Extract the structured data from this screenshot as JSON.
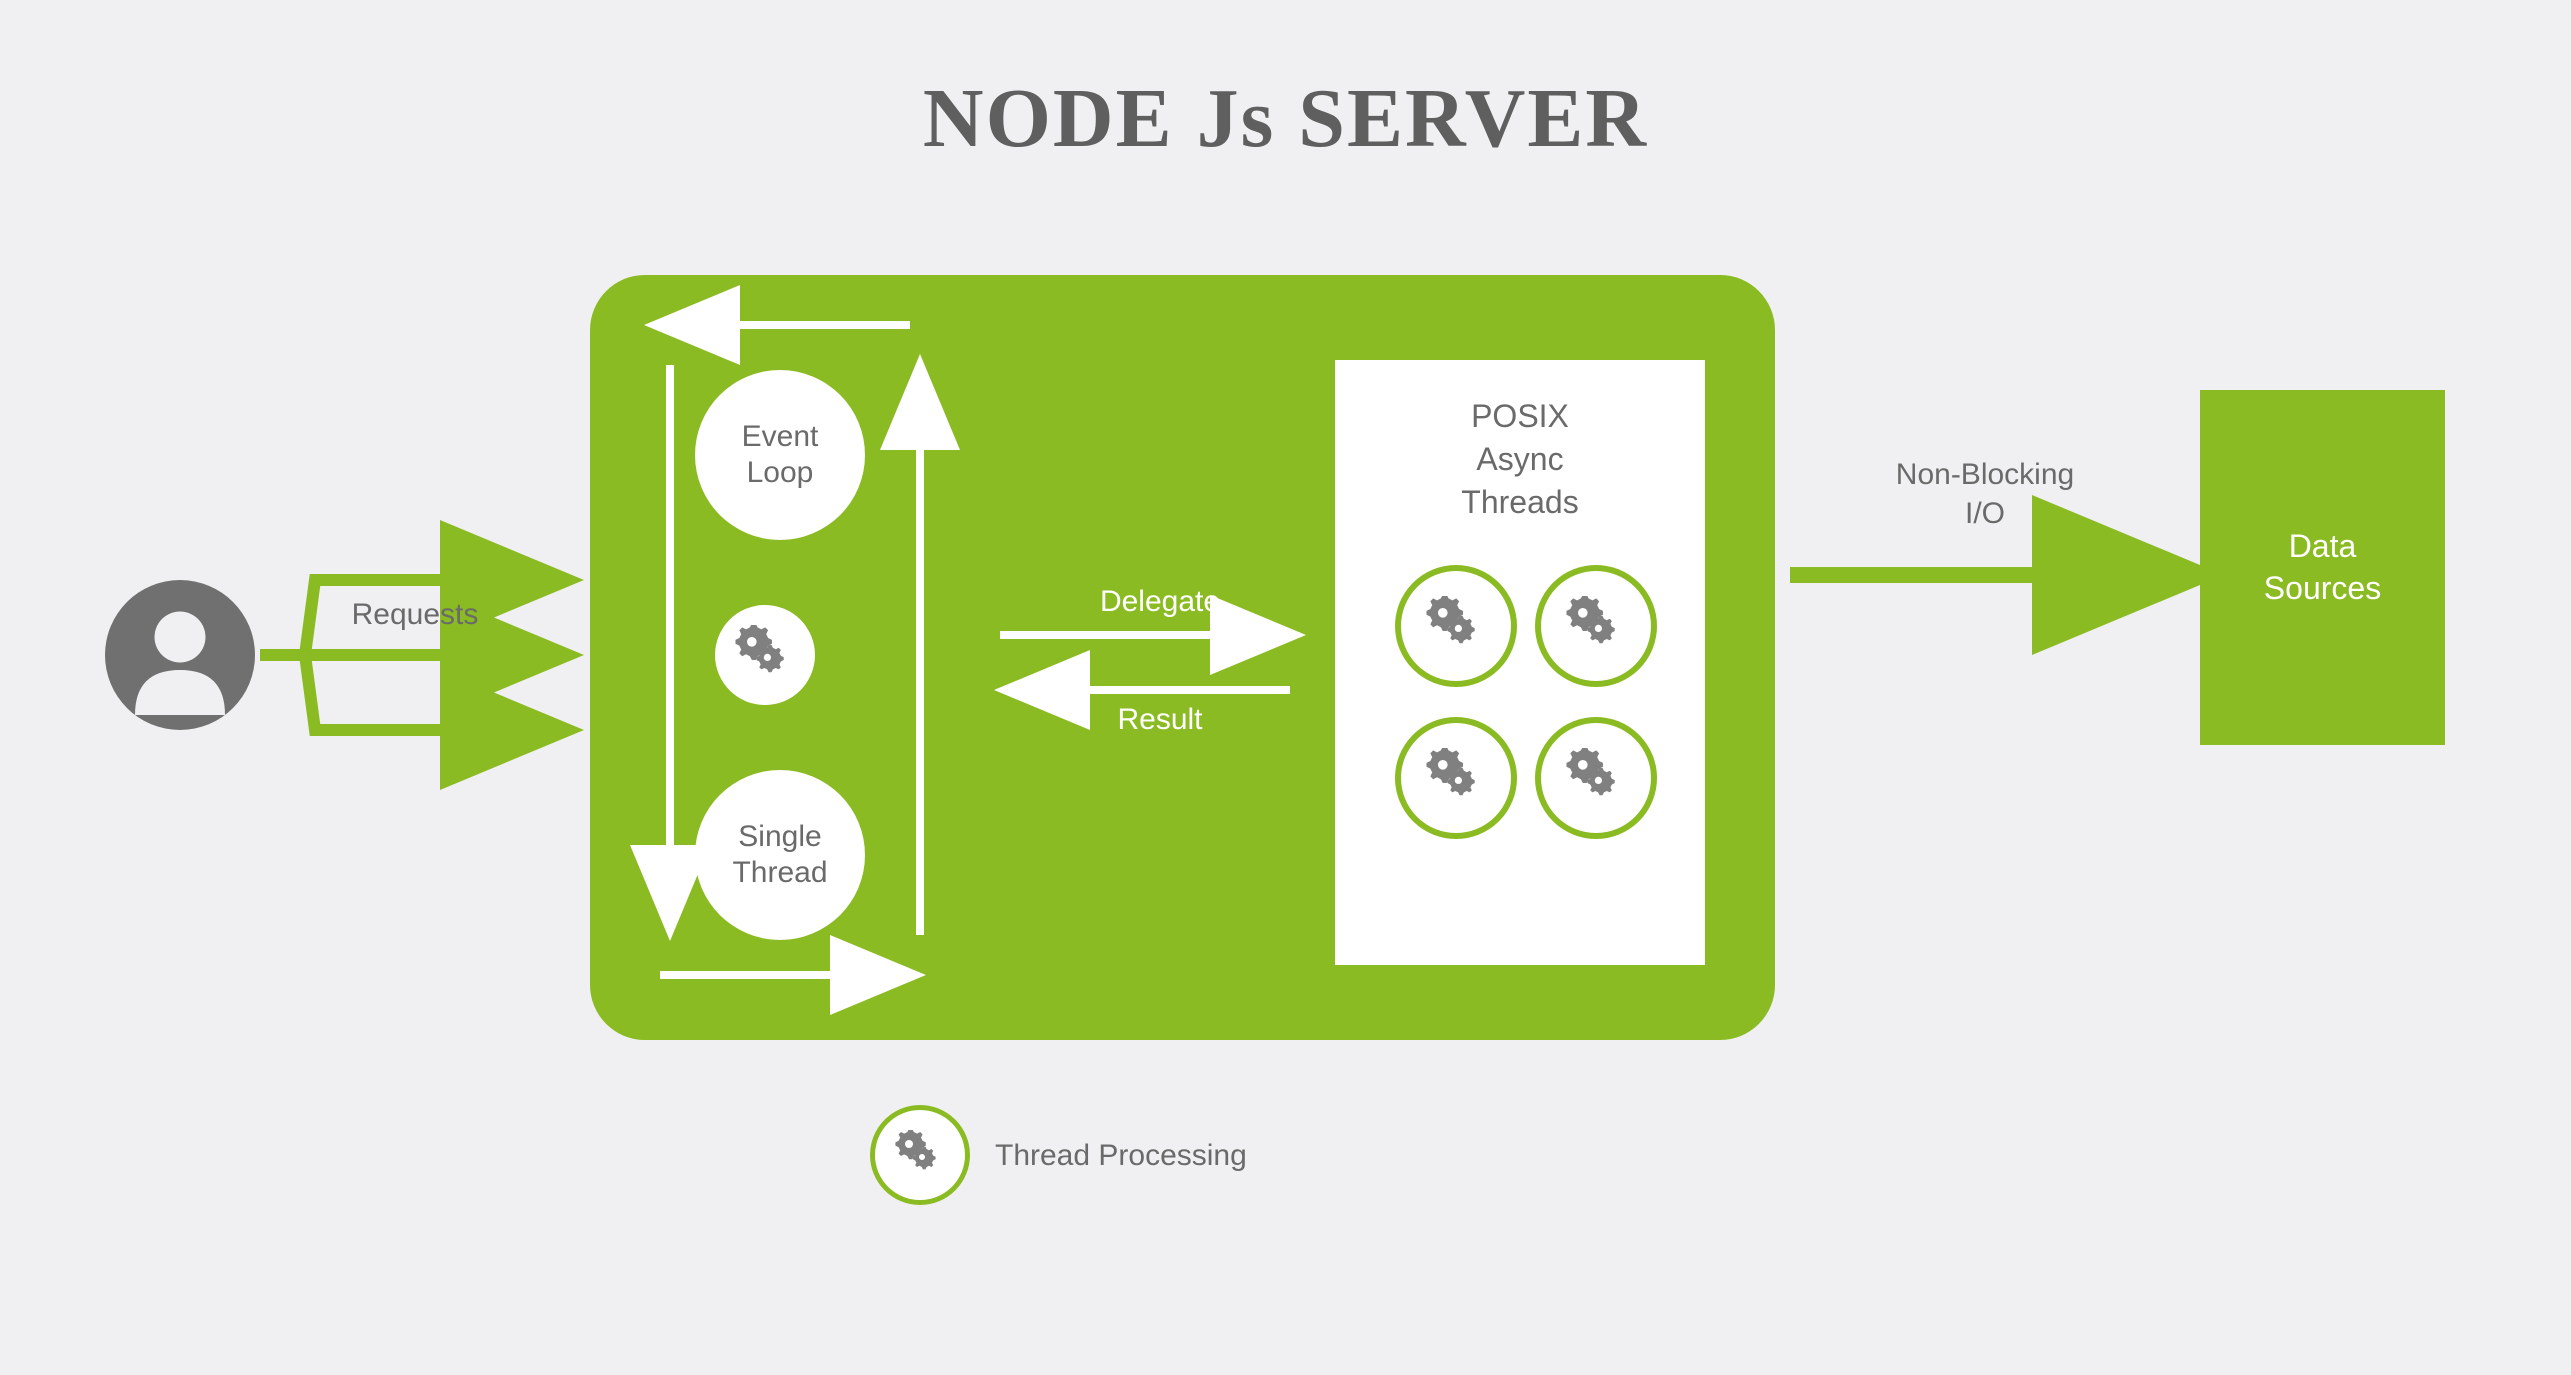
{
  "title": "NODE Js SERVER",
  "labels": {
    "requests": "Requests",
    "event_loop": "Event\nLoop",
    "single_thread": "Single\nThread",
    "delegate": "Delegate",
    "result": "Result",
    "posix": "POSIX\nAsync\nThreads",
    "non_blocking": "Non-Blocking\nI/O",
    "data_sources": "Data\nSources",
    "legend": "Thread Processing"
  },
  "colors": {
    "accent": "#8bbb22",
    "bg": "#f0f0f2",
    "text": "#6a6a6a",
    "title": "#5f5f5f"
  },
  "diagram": {
    "user_requests": 3,
    "posix_threads": 4
  }
}
